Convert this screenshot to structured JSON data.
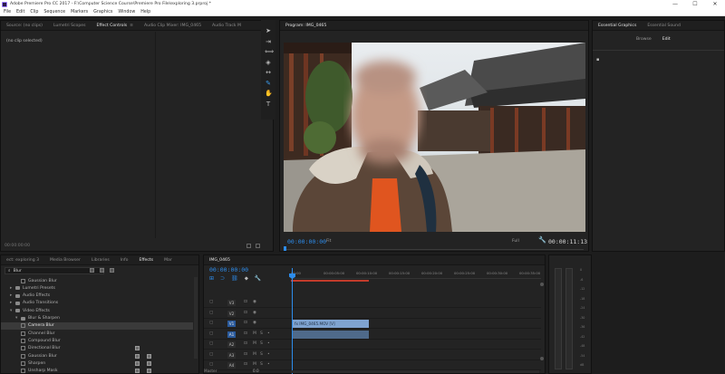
{
  "window": {
    "title": "Adobe Premiere Pro CC 2017 - F:\\Computer Science Course\\Premiere Pro File\\exploring 3.prproj *",
    "controls": {
      "minimize": "—",
      "maximize": "☐",
      "close": "✕"
    }
  },
  "menu": [
    "File",
    "Edit",
    "Clip",
    "Sequence",
    "Markers",
    "Graphics",
    "Window",
    "Help"
  ],
  "source_panel": {
    "tabs": [
      {
        "label": "Source: (no clips)",
        "active": false
      },
      {
        "label": "Lumetri Scopes",
        "active": false
      },
      {
        "label": "Effect Controls",
        "active": true
      },
      {
        "label": "Audio Clip Mixer: IMG_0465",
        "active": false
      },
      {
        "label": "Audio Track M",
        "active": false
      }
    ],
    "no_clip_text": "(no clip selected)",
    "timecode": "00:00:00:00",
    "tab_menu_glyph": "≡"
  },
  "tools": [
    {
      "name": "selection-tool-icon",
      "glyph": "➤",
      "active": false
    },
    {
      "name": "track-select-tool-icon",
      "glyph": "⇥",
      "active": false
    },
    {
      "name": "ripple-edit-tool-icon",
      "glyph": "⟺",
      "active": false
    },
    {
      "name": "razor-tool-icon",
      "glyph": "◈",
      "active": false
    },
    {
      "name": "slip-tool-icon",
      "glyph": "↔",
      "active": false
    },
    {
      "name": "pen-tool-icon",
      "glyph": "✎",
      "active": true
    },
    {
      "name": "hand-tool-icon",
      "glyph": "✋",
      "active": false
    },
    {
      "name": "type-tool-icon",
      "glyph": "T",
      "active": false
    }
  ],
  "program_panel": {
    "tab": "Program: IMG_0465",
    "timecode_left": "00:00:00:00",
    "fit": "Fit",
    "quality": "Full",
    "timecode_right": "00:00:11:13",
    "transport": {
      "marker": "⬥",
      "in": "{",
      "out": "}",
      "go_in": "|◀",
      "step_back": "◀|",
      "play": "▶",
      "step_fwd": "|▶",
      "go_out": "▶|",
      "lift": "⊞",
      "extract": "⊟",
      "export_frame": "⊙",
      "btn1": "⊡",
      "btn2": "⊠"
    },
    "add": "+"
  },
  "essential_graphics": {
    "tabs": [
      {
        "label": "Essential Graphics",
        "active": true
      },
      {
        "label": "Essential Sound",
        "active": false
      }
    ],
    "subtabs": [
      {
        "label": "Browse",
        "active": false
      },
      {
        "label": "Edit",
        "active": true
      }
    ],
    "sq": "▪"
  },
  "effects_panel": {
    "tabs": [
      {
        "label": "ect: exploring 3",
        "active": false
      },
      {
        "label": "Media Browser",
        "active": false
      },
      {
        "label": "Libraries",
        "active": false
      },
      {
        "label": "Info",
        "active": false
      },
      {
        "label": "Effects",
        "active": true
      },
      {
        "label": "Mar",
        "active": false
      }
    ],
    "search_value": "Blur",
    "tree": [
      {
        "label": "Gaussian Blur",
        "kind": "fx",
        "indent": 3
      },
      {
        "label": "Lumetri Presets",
        "kind": "folder",
        "indent": 1
      },
      {
        "label": "Audio Effects",
        "kind": "folder",
        "indent": 1
      },
      {
        "label": "Audio Transitions",
        "kind": "folder",
        "indent": 1
      },
      {
        "label": "Video Effects",
        "kind": "folder",
        "indent": 1
      },
      {
        "label": "Blur & Sharpen",
        "kind": "folder",
        "indent": 2
      },
      {
        "label": "Camera Blur",
        "kind": "fx",
        "indent": 3,
        "selected": true
      },
      {
        "label": "Channel Blur",
        "kind": "fx",
        "indent": 3
      },
      {
        "label": "Compound Blur",
        "kind": "fx",
        "indent": 3
      },
      {
        "label": "Directional Blur",
        "kind": "fx",
        "indent": 3
      },
      {
        "label": "Gaussian Blur",
        "kind": "fx",
        "indent": 3
      },
      {
        "label": "Sharpen",
        "kind": "fx",
        "indent": 3
      },
      {
        "label": "Unsharp Mask",
        "kind": "fx",
        "indent": 3
      }
    ]
  },
  "timeline": {
    "tab": "IMG_0465",
    "timecode": "00:00:00:00",
    "ruler": [
      "00:00",
      "00:00:05:00",
      "00:00:10:00",
      "00:00:15:00",
      "00:00:20:00",
      "00:00:25:00",
      "00:00:30:00",
      "00:00:35:00"
    ],
    "tracks": [
      {
        "id": "V3",
        "type": "video"
      },
      {
        "id": "V2",
        "type": "video"
      },
      {
        "id": "V1",
        "type": "video",
        "selected": true
      },
      {
        "id": "A1",
        "type": "audio",
        "selected": true
      },
      {
        "id": "A2",
        "type": "audio"
      },
      {
        "id": "A3",
        "type": "audio"
      },
      {
        "id": "A4",
        "type": "audio"
      }
    ],
    "video_clip": "fx  IMG_0465.MOV [V]",
    "track_icons": {
      "lock": "🔒",
      "sync": "⊡",
      "eye": "👁",
      "m": "M",
      "s": "S",
      "mic": "🎙"
    },
    "master_label": "Master",
    "master_value": "0.0"
  },
  "meter": {
    "scale": [
      "0",
      "-6",
      "-12",
      "-18",
      "-24",
      "-30",
      "-36",
      "-42",
      "-48",
      "-54",
      "dB"
    ]
  }
}
